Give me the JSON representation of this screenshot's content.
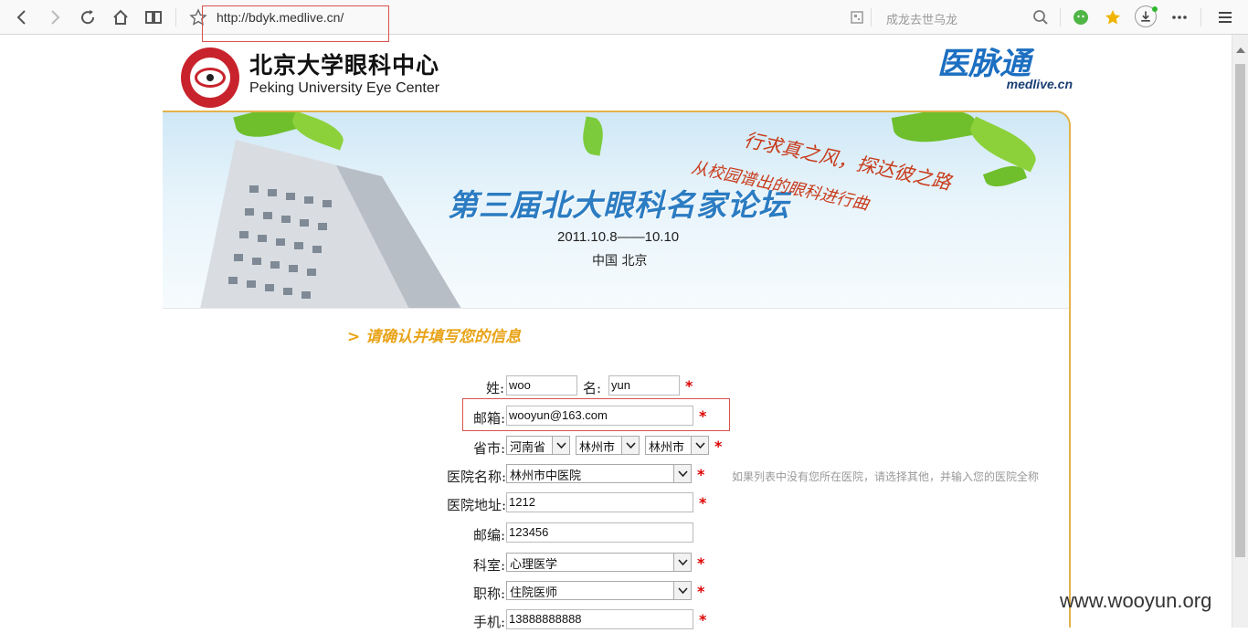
{
  "browser": {
    "url": "http://bdyk.medlive.cn/",
    "search_placeholder": "成龙去世乌龙"
  },
  "header": {
    "logo_cn": "北京大学眼科中心",
    "logo_en": "Peking University Eye Center",
    "medlive_cn": "医脉通",
    "medlive_en": "medlive.cn"
  },
  "banner": {
    "title": "第三届北大眼科名家论坛",
    "date": "2011.10.8——10.10",
    "location": "中国 北京",
    "slogan_line1": "行求真之风，探达彼之路",
    "slogan_line2": "从校园谱出的眼科进行曲"
  },
  "form": {
    "section_title": "> 请确认并填写您的信息",
    "surname_label": "姓:",
    "surname_value": "woo",
    "given_label": "名:",
    "given_value": "yun",
    "email_label": "邮箱:",
    "email_value": "wooyun@163.com",
    "region_label": "省市:",
    "province": "河南省",
    "city": "林州市",
    "district": "林州市",
    "hospital_label": "医院名称:",
    "hospital_value": "林州市中医院",
    "hospital_hint": "如果列表中没有您所在医院，请选择其他，并输入您的医院全称",
    "address_label": "医院地址:",
    "address_value": "1212",
    "zip_label": "邮编:",
    "zip_value": "123456",
    "dept_label": "科室:",
    "dept_value": "心理医学",
    "title_label": "职称:",
    "title_value": "住院医师",
    "phone_label": "手机:",
    "phone_value": "13888888888",
    "required_mark": "*"
  },
  "watermark": "www.wooyun.org"
}
